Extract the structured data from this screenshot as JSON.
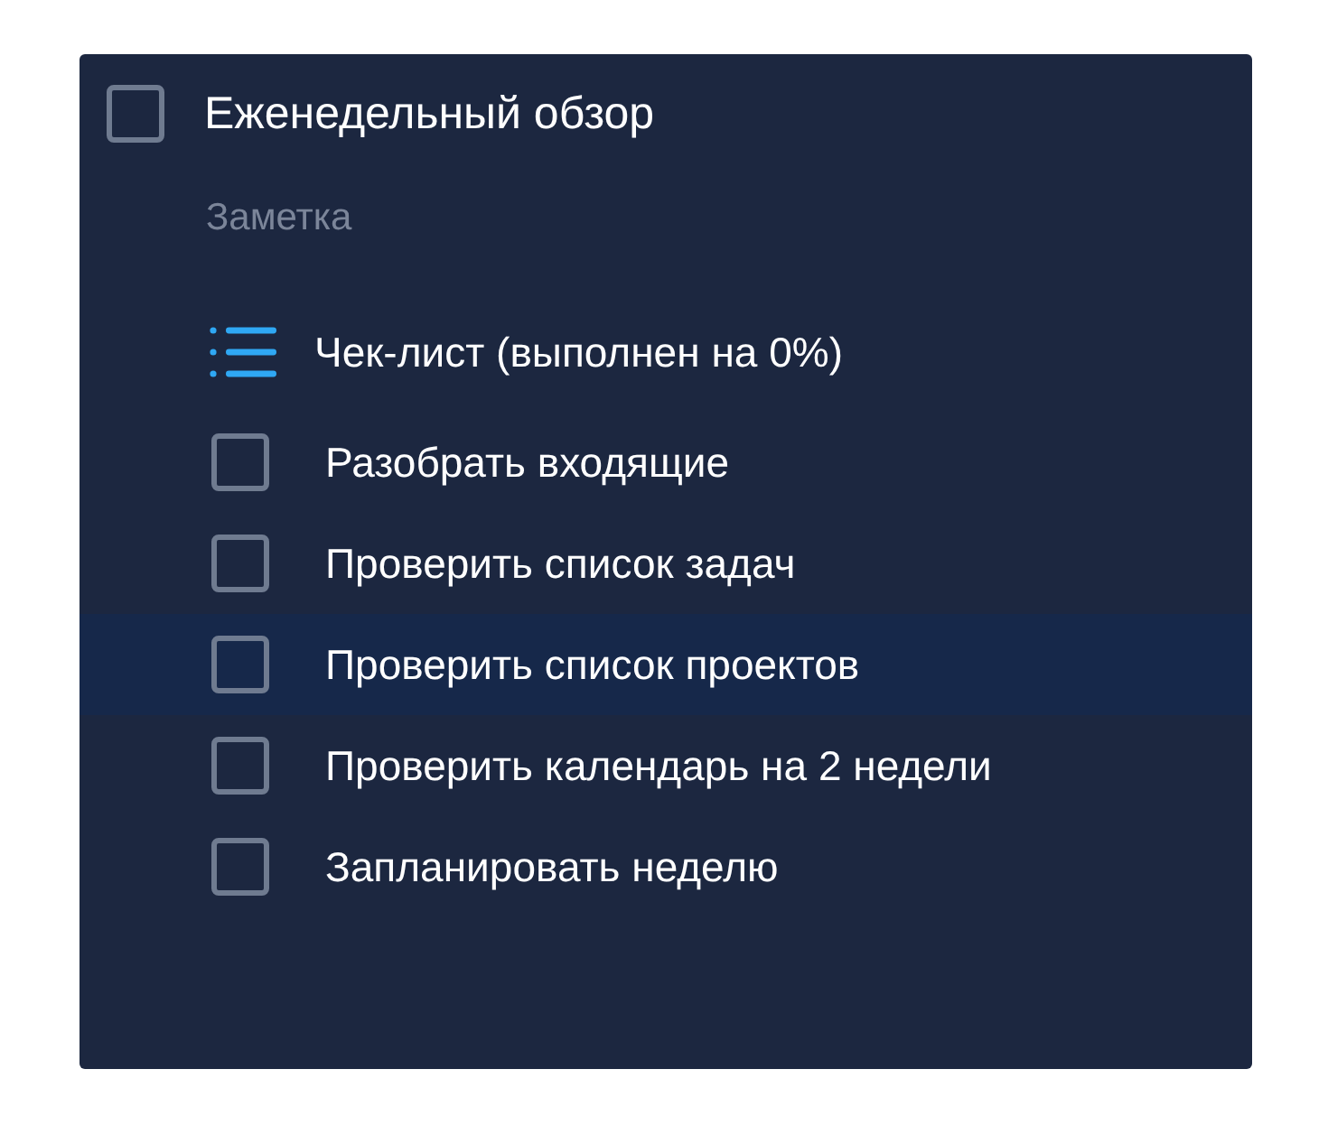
{
  "task": {
    "title": "Еженедельный обзор",
    "checked": false
  },
  "note": {
    "placeholder": "Заметка"
  },
  "checklist": {
    "heading": "Чек-лист (выполнен на 0%)",
    "items": [
      {
        "label": "Разобрать входящие",
        "checked": false,
        "selected": false
      },
      {
        "label": "Проверить список задач",
        "checked": false,
        "selected": false
      },
      {
        "label": "Проверить список проектов",
        "checked": false,
        "selected": true
      },
      {
        "label": "Проверить календарь на 2 недели",
        "checked": false,
        "selected": false
      },
      {
        "label": "Запланировать неделю",
        "checked": false,
        "selected": false
      }
    ]
  }
}
